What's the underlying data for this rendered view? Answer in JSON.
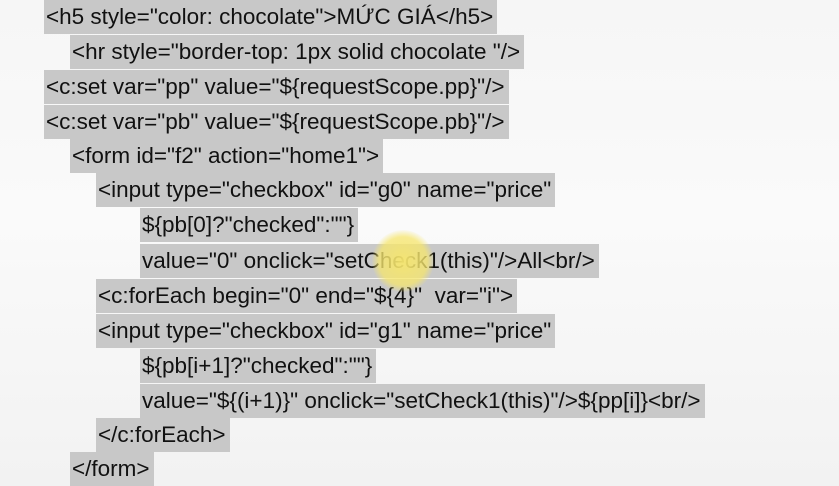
{
  "code": {
    "lines": [
      "<h5 style=\"color: chocolate\">MỨC GIÁ</h5>",
      "<hr style=\"border-top: 1px solid chocolate \"/>",
      "<c:set var=\"pp\" value=\"${requestScope.pp}\"/>",
      "<c:set var=\"pb\" value=\"${requestScope.pb}\"/>",
      "<form id=\"f2\" action=\"home1\">",
      "<input type=\"checkbox\" id=\"g0\" name=\"price\"",
      "${pb[0]?\"checked\":\"\"}",
      "value=\"0\" onclick=\"setCheck1(this)\"/>All<br/>",
      "<c:forEach begin=\"0\" end=\"${4}\"  var=\"i\">",
      "<input type=\"checkbox\" id=\"g1\" name=\"price\"",
      "${pb[i+1]?\"checked\":\"\"}",
      "value=\"${(i+1)}\" onclick=\"setCheck1(this)\"/>${pp[i]}<br/>",
      "</c:forEach>",
      "</form>"
    ]
  },
  "colors": {
    "selection": "#c8c8c8",
    "cursor_highlight": "#f6e66e",
    "text": "#111111"
  }
}
